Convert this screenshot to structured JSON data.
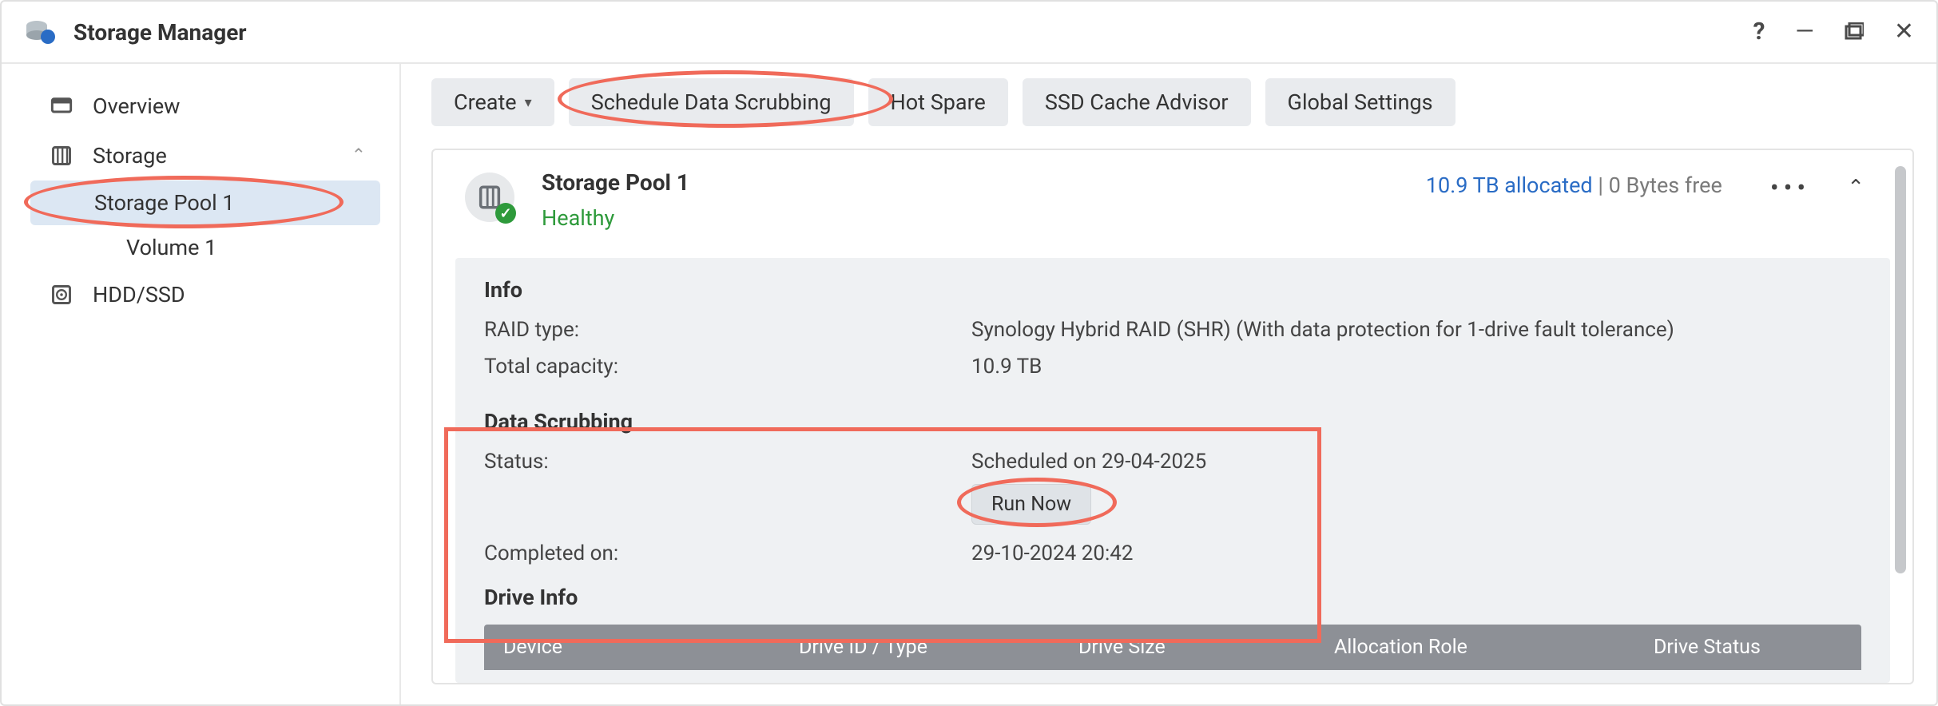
{
  "window": {
    "title": "Storage Manager"
  },
  "sidebar": {
    "overview": "Overview",
    "storage": "Storage",
    "storage_items": [
      {
        "label": "Storage Pool 1"
      },
      {
        "label": "Volume 1"
      }
    ],
    "hdd_ssd": "HDD/SSD"
  },
  "toolbar": {
    "create": "Create",
    "schedule": "Schedule Data Scrubbing",
    "hotspare": "Hot Spare",
    "ssdadvisor": "SSD Cache Advisor",
    "globalsettings": "Global Settings"
  },
  "pool": {
    "title": "Storage Pool 1",
    "status": "Healthy",
    "allocated": "10.9 TB allocated",
    "free": "0 Bytes free",
    "info": {
      "heading": "Info",
      "raid_label": "RAID type:",
      "raid_value": "Synology Hybrid RAID (SHR) (With data protection for 1-drive fault tolerance)",
      "capacity_label": "Total capacity:",
      "capacity_value": "10.9 TB"
    },
    "scrub": {
      "heading": "Data Scrubbing",
      "status_label": "Status:",
      "status_value": "Scheduled on 29-04-2025",
      "run_now": "Run Now",
      "completed_label": "Completed on:",
      "completed_value": "29-10-2024 20:42"
    },
    "drive_info": {
      "heading": "Drive Info",
      "cols": {
        "device": "Device",
        "driveid": "Drive ID / Type",
        "size": "Drive Size",
        "role": "Allocation Role",
        "status": "Drive Status"
      }
    }
  }
}
